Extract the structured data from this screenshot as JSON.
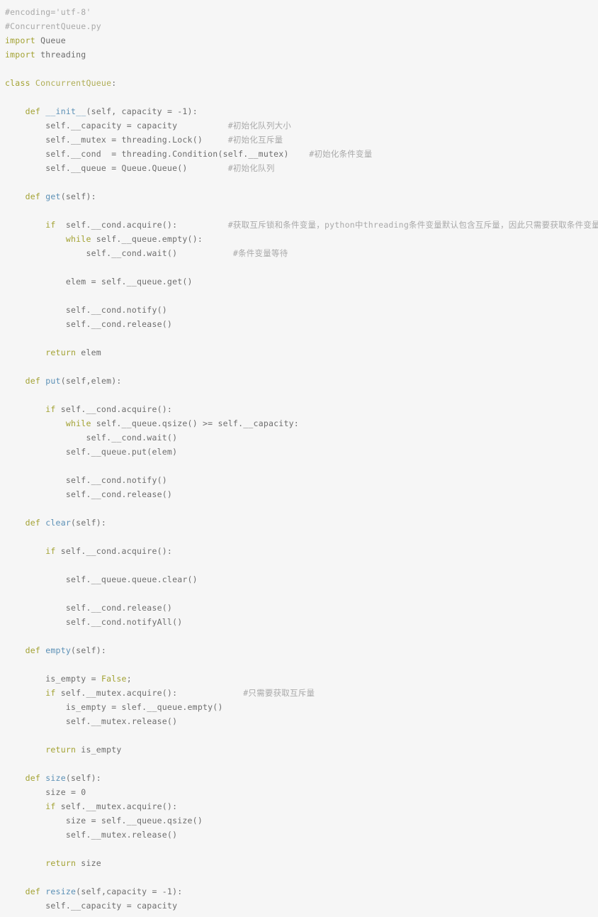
{
  "editor": {
    "language": "python",
    "filename": "ConcurrentQueue.py",
    "background_color": "#f6f6f6",
    "colors": {
      "comment": "#a9a9a9",
      "keyword": "#a3a233",
      "function_name": "#5b90b6",
      "class_name": "#b0ae57",
      "plain_text": "#6d6d6d"
    }
  },
  "code": {
    "lines": [
      {
        "indent": 0,
        "tokens": [
          {
            "t": "comment",
            "v": "#encoding='utf-8'"
          }
        ]
      },
      {
        "indent": 0,
        "tokens": [
          {
            "t": "comment",
            "v": "#ConcurrentQueue.py"
          }
        ]
      },
      {
        "indent": 0,
        "tokens": [
          {
            "t": "keyword",
            "v": "import"
          },
          {
            "t": "plain",
            "v": " Queue"
          }
        ]
      },
      {
        "indent": 0,
        "tokens": [
          {
            "t": "keyword",
            "v": "import"
          },
          {
            "t": "plain",
            "v": " threading"
          }
        ]
      },
      {
        "indent": 0,
        "tokens": []
      },
      {
        "indent": 0,
        "tokens": [
          {
            "t": "keyword",
            "v": "class"
          },
          {
            "t": "class",
            "v": " ConcurrentQueue"
          },
          {
            "t": "plain",
            "v": ":"
          }
        ]
      },
      {
        "indent": 0,
        "tokens": []
      },
      {
        "indent": 1,
        "tokens": [
          {
            "t": "keyword",
            "v": "def"
          },
          {
            "t": "func",
            "v": " __init__"
          },
          {
            "t": "plain",
            "v": "(self, capacity = -1):"
          }
        ]
      },
      {
        "indent": 2,
        "tokens": [
          {
            "t": "plain",
            "v": "self.__capacity = capacity"
          },
          {
            "t": "comment",
            "v": "          #初始化队列大小"
          }
        ]
      },
      {
        "indent": 2,
        "tokens": [
          {
            "t": "plain",
            "v": "self.__mutex = threading.Lock()"
          },
          {
            "t": "comment",
            "v": "     #初始化互斥量"
          }
        ]
      },
      {
        "indent": 2,
        "tokens": [
          {
            "t": "plain",
            "v": "self.__cond  = threading.Condition(self.__mutex)"
          },
          {
            "t": "comment",
            "v": "    #初始化条件变量"
          }
        ]
      },
      {
        "indent": 2,
        "tokens": [
          {
            "t": "plain",
            "v": "self.__queue = Queue.Queue()"
          },
          {
            "t": "comment",
            "v": "        #初始化队列"
          }
        ]
      },
      {
        "indent": 0,
        "tokens": []
      },
      {
        "indent": 1,
        "tokens": [
          {
            "t": "keyword",
            "v": "def"
          },
          {
            "t": "func",
            "v": " get"
          },
          {
            "t": "plain",
            "v": "(self):"
          }
        ]
      },
      {
        "indent": 0,
        "tokens": []
      },
      {
        "indent": 2,
        "tokens": [
          {
            "t": "keyword",
            "v": "if"
          },
          {
            "t": "plain",
            "v": "  self.__cond.acquire():"
          },
          {
            "t": "comment",
            "v": "          #获取互斥锁和条件变量，python中threading条件变量默认包含互斥量，因此只需要获取条件变量即可"
          }
        ]
      },
      {
        "indent": 3,
        "tokens": [
          {
            "t": "keyword",
            "v": "while"
          },
          {
            "t": "plain",
            "v": " self.__queue.empty():"
          }
        ]
      },
      {
        "indent": 4,
        "tokens": [
          {
            "t": "plain",
            "v": "self.__cond.wait()"
          },
          {
            "t": "comment",
            "v": "           #条件变量等待"
          }
        ]
      },
      {
        "indent": 0,
        "tokens": []
      },
      {
        "indent": 3,
        "tokens": [
          {
            "t": "plain",
            "v": "elem = self.__queue.get()"
          }
        ]
      },
      {
        "indent": 0,
        "tokens": []
      },
      {
        "indent": 3,
        "tokens": [
          {
            "t": "plain",
            "v": "self.__cond.notify()"
          }
        ]
      },
      {
        "indent": 3,
        "tokens": [
          {
            "t": "plain",
            "v": "self.__cond.release()"
          }
        ]
      },
      {
        "indent": 0,
        "tokens": []
      },
      {
        "indent": 2,
        "tokens": [
          {
            "t": "keyword",
            "v": "return"
          },
          {
            "t": "plain",
            "v": " elem"
          }
        ]
      },
      {
        "indent": 0,
        "tokens": []
      },
      {
        "indent": 1,
        "tokens": [
          {
            "t": "keyword",
            "v": "def"
          },
          {
            "t": "func",
            "v": " put"
          },
          {
            "t": "plain",
            "v": "(self,elem):"
          }
        ]
      },
      {
        "indent": 0,
        "tokens": []
      },
      {
        "indent": 2,
        "tokens": [
          {
            "t": "keyword",
            "v": "if"
          },
          {
            "t": "plain",
            "v": " self.__cond.acquire():"
          }
        ]
      },
      {
        "indent": 3,
        "tokens": [
          {
            "t": "keyword",
            "v": "while"
          },
          {
            "t": "plain",
            "v": " self.__queue.qsize() >= self.__capacity:"
          }
        ]
      },
      {
        "indent": 4,
        "tokens": [
          {
            "t": "plain",
            "v": "self.__cond.wait()"
          }
        ]
      },
      {
        "indent": 3,
        "tokens": [
          {
            "t": "plain",
            "v": "self.__queue.put(elem)"
          }
        ]
      },
      {
        "indent": 0,
        "tokens": []
      },
      {
        "indent": 3,
        "tokens": [
          {
            "t": "plain",
            "v": "self.__cond.notify()"
          }
        ]
      },
      {
        "indent": 3,
        "tokens": [
          {
            "t": "plain",
            "v": "self.__cond.release()"
          }
        ]
      },
      {
        "indent": 0,
        "tokens": []
      },
      {
        "indent": 1,
        "tokens": [
          {
            "t": "keyword",
            "v": "def"
          },
          {
            "t": "func",
            "v": " clear"
          },
          {
            "t": "plain",
            "v": "(self):"
          }
        ]
      },
      {
        "indent": 0,
        "tokens": []
      },
      {
        "indent": 2,
        "tokens": [
          {
            "t": "keyword",
            "v": "if"
          },
          {
            "t": "plain",
            "v": " self.__cond.acquire():"
          }
        ]
      },
      {
        "indent": 0,
        "tokens": []
      },
      {
        "indent": 3,
        "tokens": [
          {
            "t": "plain",
            "v": "self.__queue.queue.clear()"
          }
        ]
      },
      {
        "indent": 0,
        "tokens": []
      },
      {
        "indent": 3,
        "tokens": [
          {
            "t": "plain",
            "v": "self.__cond.release()"
          }
        ]
      },
      {
        "indent": 3,
        "tokens": [
          {
            "t": "plain",
            "v": "self.__cond.notifyAll()"
          }
        ]
      },
      {
        "indent": 0,
        "tokens": []
      },
      {
        "indent": 1,
        "tokens": [
          {
            "t": "keyword",
            "v": "def"
          },
          {
            "t": "func",
            "v": " empty"
          },
          {
            "t": "plain",
            "v": "(self):"
          }
        ]
      },
      {
        "indent": 0,
        "tokens": []
      },
      {
        "indent": 2,
        "tokens": [
          {
            "t": "plain",
            "v": "is_empty = "
          },
          {
            "t": "builtin",
            "v": "False"
          },
          {
            "t": "plain",
            "v": ";"
          }
        ]
      },
      {
        "indent": 2,
        "tokens": [
          {
            "t": "keyword",
            "v": "if"
          },
          {
            "t": "plain",
            "v": " self.__mutex.acquire():"
          },
          {
            "t": "comment",
            "v": "             #只需要获取互斥量"
          }
        ]
      },
      {
        "indent": 3,
        "tokens": [
          {
            "t": "plain",
            "v": "is_empty = slef.__queue.empty()"
          }
        ]
      },
      {
        "indent": 3,
        "tokens": [
          {
            "t": "plain",
            "v": "self.__mutex.release()"
          }
        ]
      },
      {
        "indent": 0,
        "tokens": []
      },
      {
        "indent": 2,
        "tokens": [
          {
            "t": "keyword",
            "v": "return"
          },
          {
            "t": "plain",
            "v": " is_empty"
          }
        ]
      },
      {
        "indent": 0,
        "tokens": []
      },
      {
        "indent": 1,
        "tokens": [
          {
            "t": "keyword",
            "v": "def"
          },
          {
            "t": "func",
            "v": " size"
          },
          {
            "t": "plain",
            "v": "(self):"
          }
        ]
      },
      {
        "indent": 2,
        "tokens": [
          {
            "t": "plain",
            "v": "size = 0"
          }
        ]
      },
      {
        "indent": 2,
        "tokens": [
          {
            "t": "keyword",
            "v": "if"
          },
          {
            "t": "plain",
            "v": " self.__mutex.acquire():"
          }
        ]
      },
      {
        "indent": 3,
        "tokens": [
          {
            "t": "plain",
            "v": "size = self.__queue.qsize()"
          }
        ]
      },
      {
        "indent": 3,
        "tokens": [
          {
            "t": "plain",
            "v": "self.__mutex.release()"
          }
        ]
      },
      {
        "indent": 0,
        "tokens": []
      },
      {
        "indent": 2,
        "tokens": [
          {
            "t": "keyword",
            "v": "return"
          },
          {
            "t": "plain",
            "v": " size"
          }
        ]
      },
      {
        "indent": 0,
        "tokens": []
      },
      {
        "indent": 1,
        "tokens": [
          {
            "t": "keyword",
            "v": "def"
          },
          {
            "t": "func",
            "v": " resize"
          },
          {
            "t": "plain",
            "v": "(self,capacity = -1):"
          }
        ]
      },
      {
        "indent": 2,
        "tokens": [
          {
            "t": "plain",
            "v": "self.__capacity = capacity"
          }
        ]
      }
    ]
  }
}
